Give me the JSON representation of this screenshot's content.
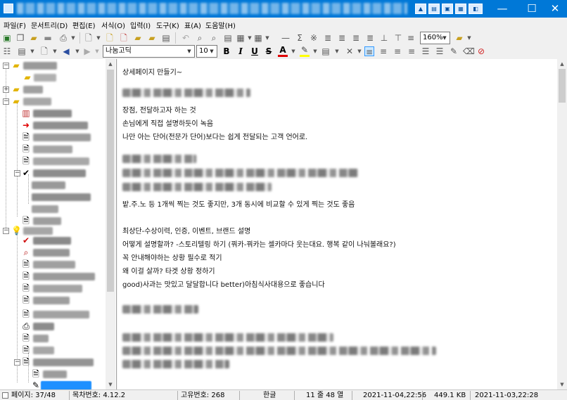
{
  "window": {
    "controls": {
      "minimize": "—",
      "maximize": "☐",
      "close": "✕"
    }
  },
  "menu": [
    "파일(F)",
    "문서트리(D)",
    "편집(E)",
    "서식(O)",
    "입력(I)",
    "도구(K)",
    "표(A)",
    "도움말(H)"
  ],
  "toolbar": {
    "zoom": "160%",
    "font_name": "나눔고딕",
    "font_size": "10",
    "bold": "B",
    "italic": "I",
    "underline": "U",
    "strike": "S",
    "font_color_glyph": "A"
  },
  "tree": {
    "selected_color": "#1e90ff"
  },
  "document": {
    "lines": [
      "상세페이지 만들기~",
      "장점, 전달하고자 하는 것",
      "손님에게 직접 설명하듯이 녹음",
      "나만 아는 단어(전문가 단어)보다는 쉽게 전달되는 고객 언어로.",
      "밭.주.노 등 1개씩 찍는 것도 좋지만, 3개 동시에 비교할 수 있게 찍는 것도 좋음",
      "최상단-수상이력, 인증, 이벤트, 브랜드 설명",
      "어떻게 설명할까? -스토리텔링 하기 (꿔카-꿔카는 셀카마다 웃는대요. 행복 같이 나눠볼래요?)",
      "꼭 안내해야하는 상황 필수로 적기",
      "왜 이걸 살까? 타겟 상황 정하기",
      "good)사과는 맛있고 달달합니다 better)아침식사대용으로 좋습니다"
    ]
  },
  "status": {
    "page": "페이지: 37/48",
    "toc": "목차번호: 4.12.2",
    "uid": "고유번호: 268",
    "ime": "한글",
    "cursor": "11 줄 48 열",
    "modified": "2021-11-04,22:56",
    "size": "449.1 KB",
    "created": "2021-11-03,22:28"
  }
}
